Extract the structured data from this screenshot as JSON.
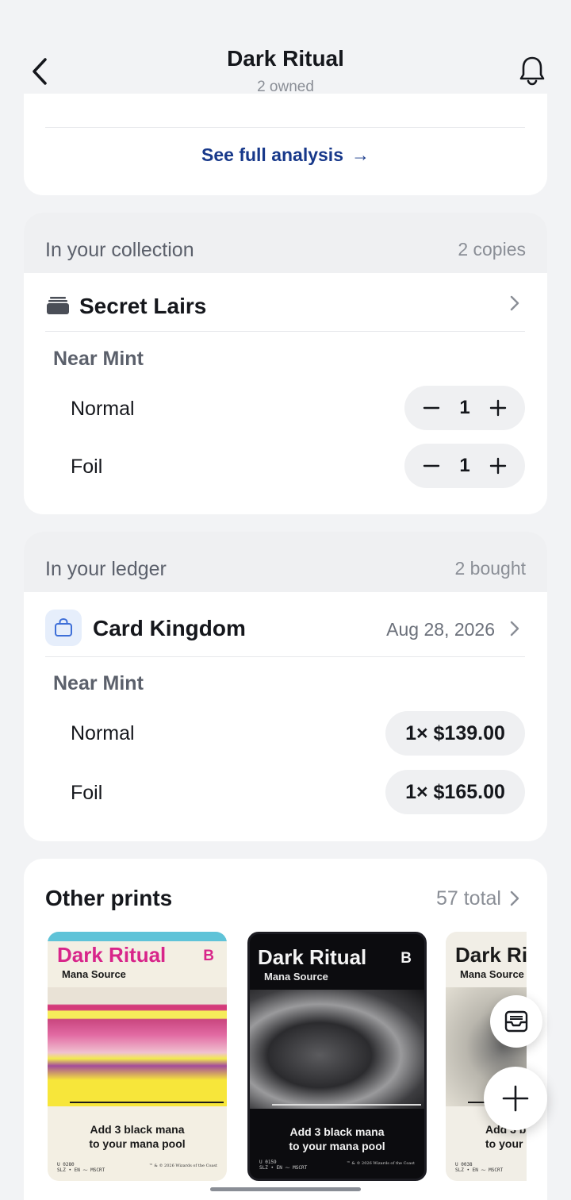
{
  "header": {
    "title": "Dark Ritual",
    "subtitle": "2 owned"
  },
  "analysis": {
    "link_label": "See full analysis",
    "arrow": "→"
  },
  "collection": {
    "title": "In your collection",
    "count": "2 copies",
    "group": {
      "icon": "card-stack-icon",
      "name": "Secret Lairs"
    },
    "condition": "Near Mint",
    "rows": [
      {
        "label": "Normal",
        "qty": "1"
      },
      {
        "label": "Foil",
        "qty": "1"
      }
    ]
  },
  "ledger": {
    "title": "In your ledger",
    "count": "2 bought",
    "vendor": {
      "icon": "shopping-bag-icon",
      "name": "Card Kingdom",
      "date": "Aug 28, 2026"
    },
    "condition": "Near Mint",
    "rows": [
      {
        "label": "Normal",
        "price": "1× $139.00"
      },
      {
        "label": "Foil",
        "price": "1× $165.00"
      }
    ]
  },
  "other_prints": {
    "title": "Other prints",
    "count": "57 total",
    "cards": [
      {
        "name": "Dark Ritual",
        "symbol": "B",
        "type": "Mana Source",
        "rules_line1": "Add 3 black mana",
        "rules_line2": "to your mana pool",
        "collector_line1": "U 0280",
        "collector_line2": "SLZ • EN ⁓ MSCRT",
        "copyright": "™ & © 2026 Wizards of the Coast"
      },
      {
        "name": "Dark Ritual",
        "symbol": "B",
        "type": "Mana Source",
        "rules_line1": "Add 3 black mana",
        "rules_line2": "to your mana pool",
        "collector_line1": "U 0159",
        "collector_line2": "SLZ • EN ⁓ MSCRT",
        "copyright": "™ & © 2026 Wizards of the Coast"
      },
      {
        "name": "Dark Ri",
        "symbol": "",
        "type": "Mana Source",
        "rules_line1": "Add 3 b",
        "rules_line2": "to your",
        "collector_line1": "U 0038",
        "collector_line2": "SLZ • EN ⁓ MSCRT",
        "copyright": ""
      }
    ]
  },
  "colors": {
    "link": "#17388a",
    "background": "#f2f3f5",
    "section_header": "#eff0f2"
  }
}
